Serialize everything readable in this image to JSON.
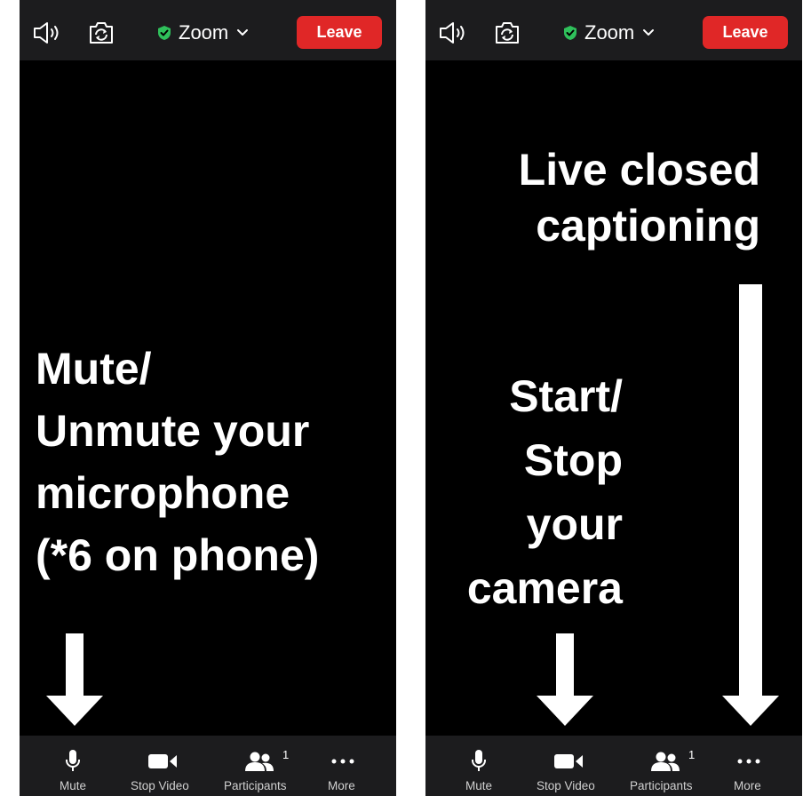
{
  "colors": {
    "background": "#000000",
    "bar": "#1c1c1e",
    "leave": "#e02727",
    "shield": "#2fc05b",
    "annotation": "#ffffff"
  },
  "left_screen": {
    "top_bar": {
      "speaker_icon": "speaker-icon",
      "camera_switch_icon": "camera-switch-icon",
      "title": "Zoom",
      "secure_icon": "shield-check-icon",
      "leave_label": "Leave"
    },
    "annotation": "Mute/\nUnmute your\nmicrophone\n(*6 on phone)",
    "toolbar": [
      {
        "label": "Mute",
        "icon": "microphone-icon"
      },
      {
        "label": "Stop Video",
        "icon": "video-camera-icon"
      },
      {
        "label": "Participants",
        "icon": "participants-icon",
        "badge": "1"
      },
      {
        "label": "More",
        "icon": "more-dots-icon"
      }
    ]
  },
  "right_screen": {
    "top_bar": {
      "speaker_icon": "speaker-icon",
      "camera_switch_icon": "camera-switch-icon",
      "title": "Zoom",
      "secure_icon": "shield-check-icon",
      "leave_label": "Leave"
    },
    "annotation_captions": "Live closed\ncaptioning",
    "annotation_camera": "Start/\nStop\nyour\ncamera",
    "toolbar": [
      {
        "label": "Mute",
        "icon": "microphone-icon"
      },
      {
        "label": "Stop Video",
        "icon": "video-camera-icon"
      },
      {
        "label": "Participants",
        "icon": "participants-icon",
        "badge": "1"
      },
      {
        "label": "More",
        "icon": "more-dots-icon"
      }
    ]
  }
}
